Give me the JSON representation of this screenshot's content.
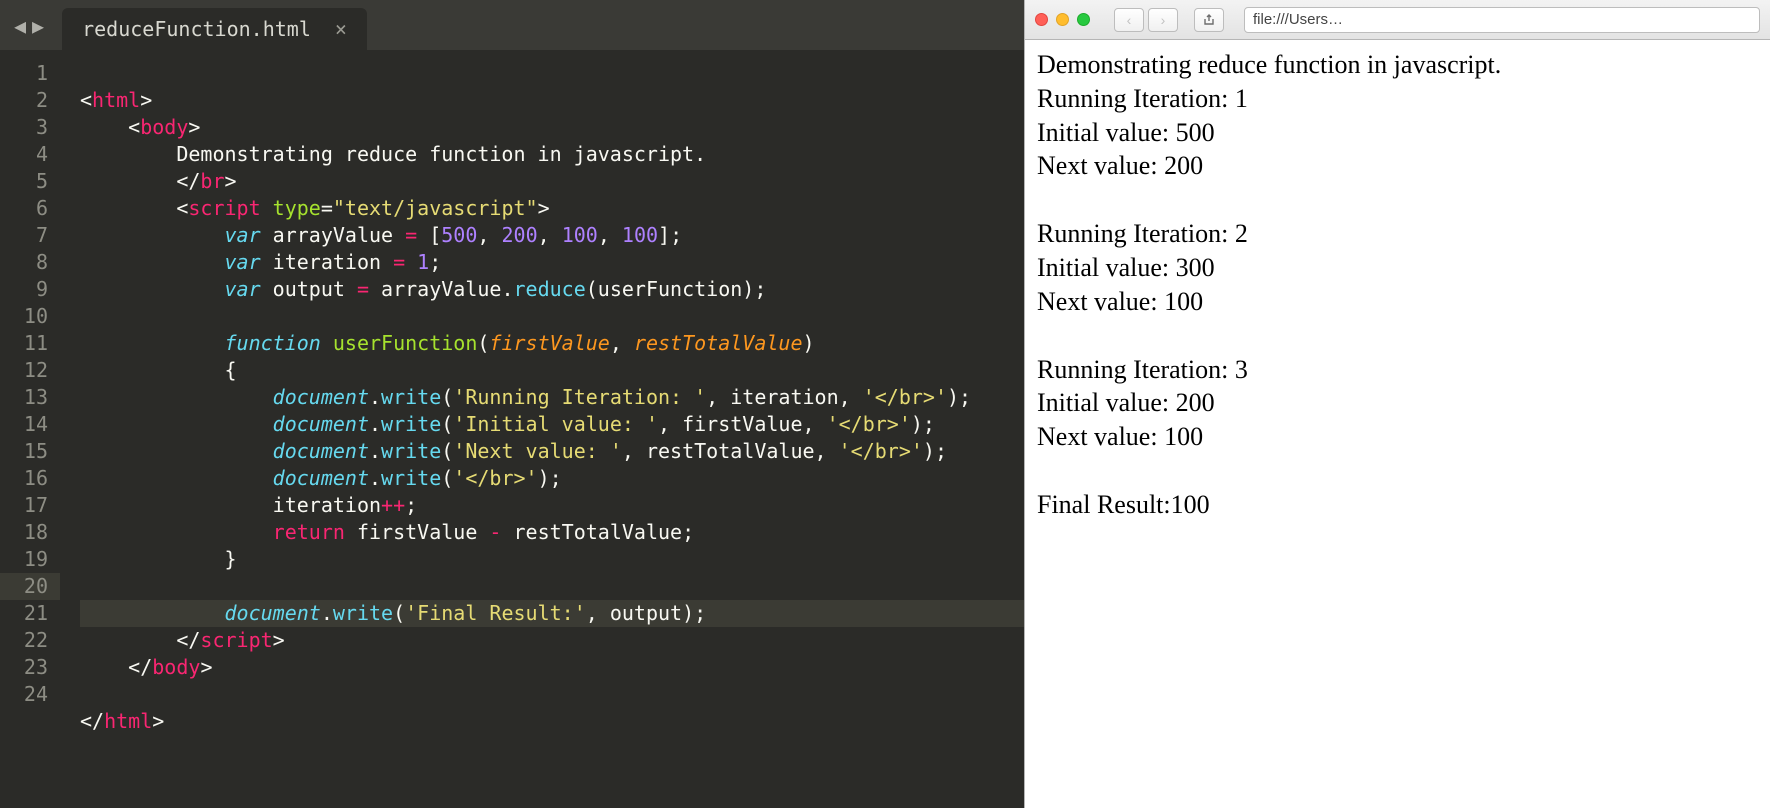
{
  "editor": {
    "tab_title": "reduceFunction.html",
    "tab_close_glyph": "×",
    "nav_back_glyph": "◀",
    "nav_fwd_glyph": "▶",
    "line_numbers": [
      "1",
      "2",
      "3",
      "4",
      "5",
      "6",
      "7",
      "8",
      "9",
      "10",
      "11",
      "12",
      "13",
      "14",
      "15",
      "16",
      "17",
      "18",
      "19",
      "20",
      "21",
      "22",
      "23",
      "24"
    ],
    "highlighted_line": 20,
    "code_tokens": {
      "l1": {
        "open": "<",
        "tag": "html",
        "close": ">"
      },
      "l2": {
        "open": "<",
        "tag": "body",
        "close": ">"
      },
      "l3": {
        "text": "Demonstrating reduce function in javascript."
      },
      "l4": {
        "open": "</",
        "tag": "br",
        "close": ">"
      },
      "l5": {
        "open": "<",
        "tag": "script",
        "attr": " type",
        "eq": "=",
        "val": "\"text/javascript\"",
        "close": ">"
      },
      "l6": {
        "kw": "var",
        "name": " arrayValue ",
        "op": "=",
        "sp": " [",
        "n1": "500",
        "c1": ", ",
        "n2": "200",
        "c2": ", ",
        "n3": "100",
        "c3": ", ",
        "n4": "100",
        "end": "];"
      },
      "l7": {
        "kw": "var",
        "name": " iteration ",
        "op": "=",
        "sp": " ",
        "n": "1",
        "end": ";"
      },
      "l8": {
        "kw": "var",
        "name": " output ",
        "op": "=",
        "sp": " arrayValue.",
        "call": "reduce",
        "args": "(userFunction);"
      },
      "l10": {
        "kw": "function",
        "name": " userFunction",
        "open": "(",
        "a1": "firstValue",
        "comma": ", ",
        "a2": "restTotalValue",
        "close": ")"
      },
      "l11": {
        "brace": "{"
      },
      "l12": {
        "obj": "document",
        "dot": ".",
        "call": "write",
        "open": "(",
        "s1": "'Running Iteration: '",
        "c1": ", iteration, ",
        "s2": "'</br>'",
        "close": ");"
      },
      "l13": {
        "obj": "document",
        "dot": ".",
        "call": "write",
        "open": "(",
        "s1": "'Initial value: '",
        "c1": ", firstValue, ",
        "s2": "'</br>'",
        "close": ");"
      },
      "l14": {
        "obj": "document",
        "dot": ".",
        "call": "write",
        "open": "(",
        "s1": "'Next value: '",
        "c1": ", restTotalValue, ",
        "s2": "'</br>'",
        "close": ");"
      },
      "l15": {
        "obj": "document",
        "dot": ".",
        "call": "write",
        "open": "(",
        "s1": "'</br>'",
        "close": ");"
      },
      "l16": {
        "name": "iteration",
        "op": "++",
        "end": ";"
      },
      "l17": {
        "kw": "return",
        "expr": " firstValue ",
        "op": "-",
        "expr2": " restTotalValue;"
      },
      "l18": {
        "brace": "}"
      },
      "l20": {
        "obj": "document",
        "dot": ".",
        "call": "write",
        "open": "(",
        "s1": "'Final Result:'",
        "c1": ", output",
        "close": ");"
      },
      "l21": {
        "open": "</",
        "tag": "script",
        "close": ">"
      },
      "l22": {
        "open": "</",
        "tag": "body",
        "close": ">"
      },
      "l24": {
        "open": "</",
        "tag": "html",
        "close": ">"
      }
    }
  },
  "browser": {
    "address_text": "file:///Users…",
    "nav_back_glyph": "‹",
    "nav_fwd_glyph": "›",
    "lines": {
      "title": "Demonstrating reduce function in javascript.",
      "it1_a": "Running Iteration: 1",
      "it1_b": "Initial value: 500",
      "it1_c": "Next value: 200",
      "it2_a": "Running Iteration: 2",
      "it2_b": "Initial value: 300",
      "it2_c": "Next value: 100",
      "it3_a": "Running Iteration: 3",
      "it3_b": "Initial value: 200",
      "it3_c": "Next value: 100",
      "final": "Final Result:100"
    }
  }
}
